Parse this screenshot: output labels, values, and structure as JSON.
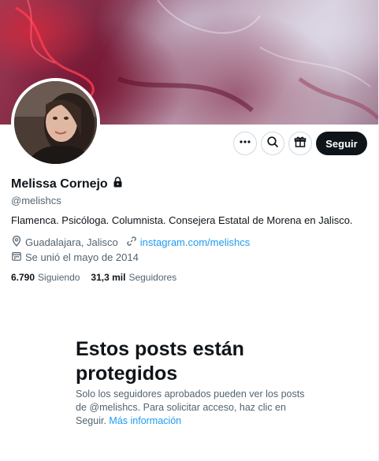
{
  "profile": {
    "name": "Melissa Cornejo",
    "handle": "@melishcs",
    "bio": "Flamenca. Psicóloga. Columnista. Consejera Estatal de Morena en Jalisco.",
    "location": "Guadalajara, Jalisco",
    "website": "instagram.com/melishcs",
    "joined": "Se unió el mayo de 2014",
    "following_count": "6.790",
    "following_label": "Siguiendo",
    "followers_count": "31,3 mil",
    "followers_label": "Seguidores"
  },
  "actions": {
    "follow_label": "Seguir",
    "more_icon": "more-dots-icon",
    "search_icon": "search-icon",
    "subscribe_icon": "gift-icon"
  },
  "protected": {
    "title": "Estos posts están protegidos",
    "description_part1": "Solo los seguidores aprobados pueden ver los posts de @melishcs. Para solicitar acceso, haz clic en Seguir.",
    "more_info_link": "Más información"
  },
  "colors": {
    "accent": "#1d9bf0",
    "primary_text": "#0f1419",
    "secondary_text": "#536471",
    "follow_button_bg": "#0f1419"
  }
}
